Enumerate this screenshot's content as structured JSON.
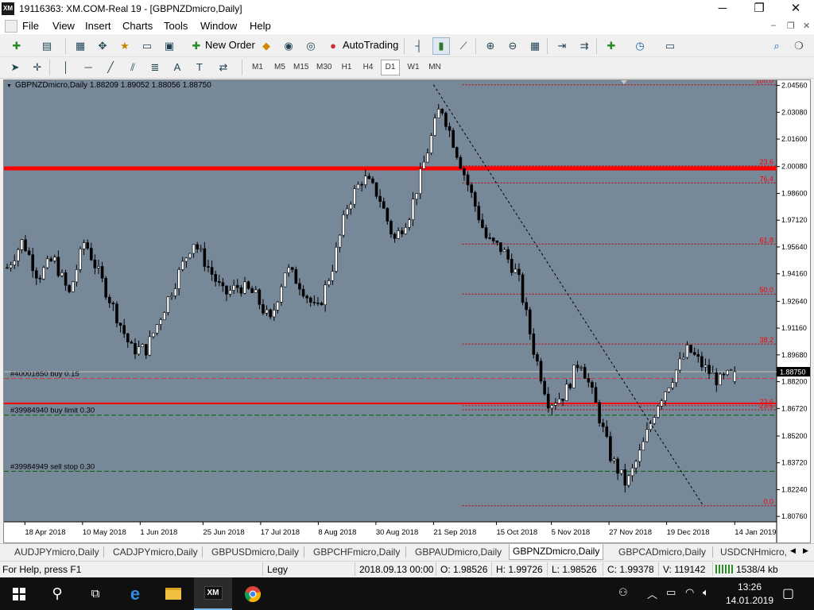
{
  "window": {
    "title": "19116363: XM.COM-Real 19 - [GBPNZDmicro,Daily]",
    "logo": "XM",
    "minimize_icon": "─",
    "restore_icon": "❐",
    "close_icon": "✕"
  },
  "menu": {
    "items": [
      "File",
      "View",
      "Insert",
      "Charts",
      "Tools",
      "Window",
      "Help"
    ],
    "mdi_minimize": "–",
    "mdi_restore": "❐",
    "mdi_close": "✕"
  },
  "toolbar1": {
    "new_order_label": "New Order",
    "autotrading_label": "AutoTrading"
  },
  "toolbar2": {
    "timeframes": [
      "M1",
      "M5",
      "M15",
      "M30",
      "H1",
      "H4",
      "D1",
      "W1",
      "MN"
    ],
    "active_timeframe": "D1"
  },
  "chart": {
    "header": "GBPNZDmicro,Daily  1.88209 1.89052 1.88056 1.88750",
    "header_arrow": "▼",
    "colors": {
      "background": "#778899",
      "candle": "#000000",
      "resistance": "#ff0000",
      "fib": "#c00000",
      "fib_text": "#ff0000",
      "order": "#006400",
      "bid": "#c0c0c0"
    },
    "orders": [
      {
        "label": "#40001850 buy 0.15",
        "price": 1.8838
      },
      {
        "label": "#39984940 buy limit 0.30",
        "price": 1.8635
      },
      {
        "label": "#39984949 sell stop 0.30",
        "price": 1.8325
      }
    ],
    "fib_levels": [
      {
        "label": "100.0",
        "price": 2.046
      },
      {
        "label": "23.6",
        "price": 2.0012
      },
      {
        "label": "76.4",
        "price": 1.9918
      },
      {
        "label": "61.8",
        "price": 1.958
      },
      {
        "label": "50.0",
        "price": 1.9304
      },
      {
        "label": "38.2",
        "price": 1.9028
      },
      {
        "label": "23.6",
        "price": 1.8687
      },
      {
        "label": "23.6",
        "price": 1.8665
      },
      {
        "label": "0.0",
        "price": 1.8135
      }
    ],
    "current_price": "1.88750"
  },
  "chart_data": {
    "type": "candlestick",
    "symbol": "GBPNZDmicro",
    "timeframe": "Daily",
    "ylim": [
      1.8046,
      2.0485
    ],
    "y_ticks": [
      "2.04560",
      "2.03080",
      "2.01600",
      "2.00080",
      "1.98600",
      "1.97120",
      "1.95640",
      "1.94160",
      "1.92640",
      "1.91160",
      "1.89680",
      "1.88200",
      "1.86720",
      "1.85200",
      "1.83720",
      "1.82240",
      "1.80760"
    ],
    "x_ticks": [
      "18 Apr 2018",
      "10 May 2018",
      "1 Jun 2018",
      "25 Jun 2018",
      "17 Jul 2018",
      "8 Aug 2018",
      "30 Aug 2018",
      "21 Sep 2018",
      "15 Oct 2018",
      "5 Nov 2018",
      "27 Nov 2018",
      "19 Dec 2018",
      "14 Jan 2019"
    ],
    "last": {
      "open": 1.88209,
      "high": 1.89052,
      "low": 1.88056,
      "close": 1.8875
    },
    "current_price_label": "1.88750",
    "resistance_lines": [
      1.9998,
      1.87
    ],
    "trend_line": {
      "from": {
        "date": "2018-09-21",
        "price": 2.046
      },
      "to": {
        "date": "2019-01-02",
        "price": 1.8135
      }
    },
    "approx_close_path": [
      1.945,
      1.96,
      1.94,
      1.95,
      1.93,
      1.96,
      1.94,
      1.92,
      1.9,
      1.9,
      1.92,
      1.94,
      1.96,
      1.945,
      1.93,
      1.935,
      1.93,
      1.915,
      1.945,
      1.935,
      1.92,
      1.945,
      1.98,
      1.995,
      1.985,
      1.96,
      1.975,
      2.005,
      2.035,
      2.01,
      1.985,
      1.96,
      1.955,
      1.94,
      1.9,
      1.87,
      1.875,
      1.895,
      1.87,
      1.84,
      1.825,
      1.845,
      1.87,
      1.885,
      1.9,
      1.89,
      1.882,
      1.8875
    ]
  }
}
